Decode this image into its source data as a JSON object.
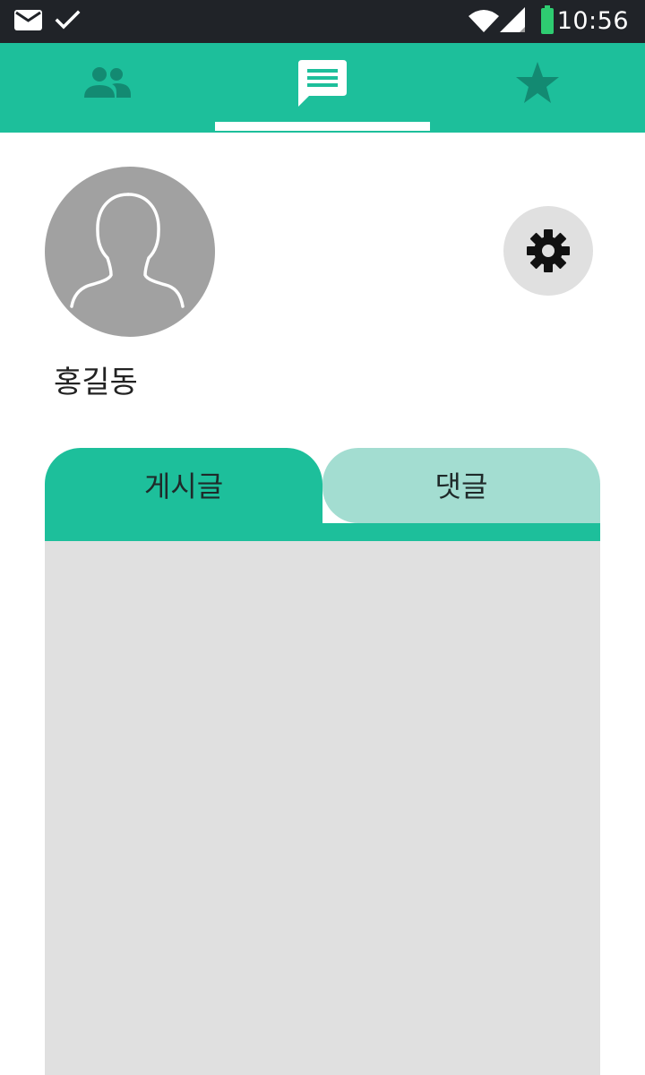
{
  "status_bar": {
    "time": "10:56",
    "icons": [
      "mail-icon",
      "check-icon",
      "wifi-icon",
      "signal-icon",
      "battery-icon"
    ],
    "battery_color": "#2ecc71"
  },
  "top_nav": {
    "background": "#1dbf9b",
    "tabs": [
      {
        "icon": "people-icon",
        "selected": false
      },
      {
        "icon": "chat-icon",
        "selected": true
      },
      {
        "icon": "star-icon",
        "selected": false
      }
    ]
  },
  "profile": {
    "name": "홍길동",
    "avatar_icon": "person-silhouette-icon",
    "settings_icon": "gear-icon"
  },
  "content_tabs": {
    "posts_label": "게시글",
    "comments_label": "댓글",
    "active": "posts_label",
    "active_color": "#1dbf9b",
    "inactive_color": "#a3ddd1"
  },
  "content_panel": {
    "background": "#e0e0e0"
  }
}
